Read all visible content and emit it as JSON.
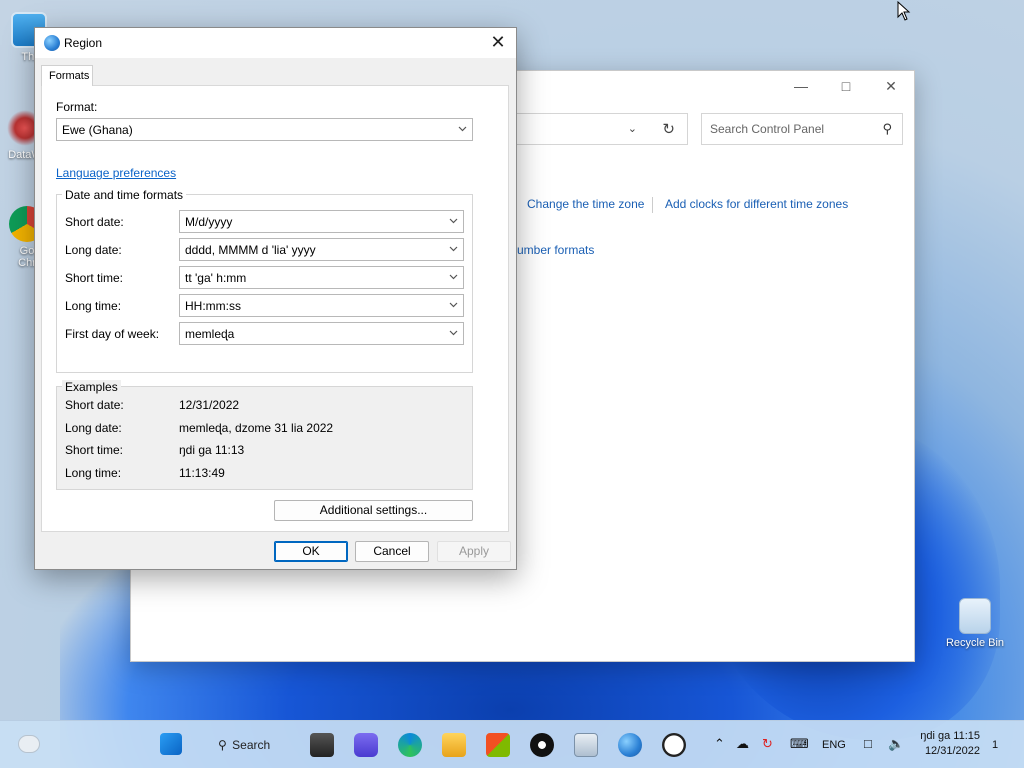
{
  "desktop": {
    "icons": [
      {
        "label": "Thi"
      },
      {
        "label": "DataW"
      },
      {
        "label": "Go\nChr"
      }
    ],
    "recycle_bin_label": "Recycle Bin"
  },
  "control_panel": {
    "search_placeholder": "Search Control Panel",
    "links": {
      "change_time_zone": "Change the time zone",
      "add_clocks": "Add clocks for different time zones",
      "number_formats": "umber formats"
    }
  },
  "region_dialog": {
    "title": "Region",
    "tab_formats": "Formats",
    "format_label": "Format:",
    "format_value": "Ewe (Ghana)",
    "language_preferences_link": "Language preferences",
    "date_time_group_title": "Date and time formats",
    "fields": [
      {
        "label": "Short date:",
        "value": "M/d/yyyy"
      },
      {
        "label": "Long date:",
        "value": "dddd, MMMM d 'lia' yyyy"
      },
      {
        "label": "Short time:",
        "value": "tt 'ga' h:mm"
      },
      {
        "label": "Long time:",
        "value": "HH:mm:ss"
      },
      {
        "label": "First day of week:",
        "value": "memleɖa"
      }
    ],
    "examples_title": "Examples",
    "examples": [
      {
        "label": "Short date:",
        "value": "12/31/2022"
      },
      {
        "label": "Long date:",
        "value": "memleɖa, dzome 31 lia 2022"
      },
      {
        "label": "Short time:",
        "value": "ŋdi ga 11:13"
      },
      {
        "label": "Long time:",
        "value": "11:13:49"
      }
    ],
    "additional_settings_label": "Additional settings...",
    "ok_label": "OK",
    "cancel_label": "Cancel",
    "apply_label": "Apply"
  },
  "taskbar": {
    "search_label": "Search",
    "language": "ENG",
    "time": "ŋdi ga 11:15",
    "date": "12/31/2022",
    "notification_count": "1"
  },
  "colors": {
    "link": "#0b63c8",
    "accent": "#0067c0",
    "taskbar": "#c8def4"
  }
}
